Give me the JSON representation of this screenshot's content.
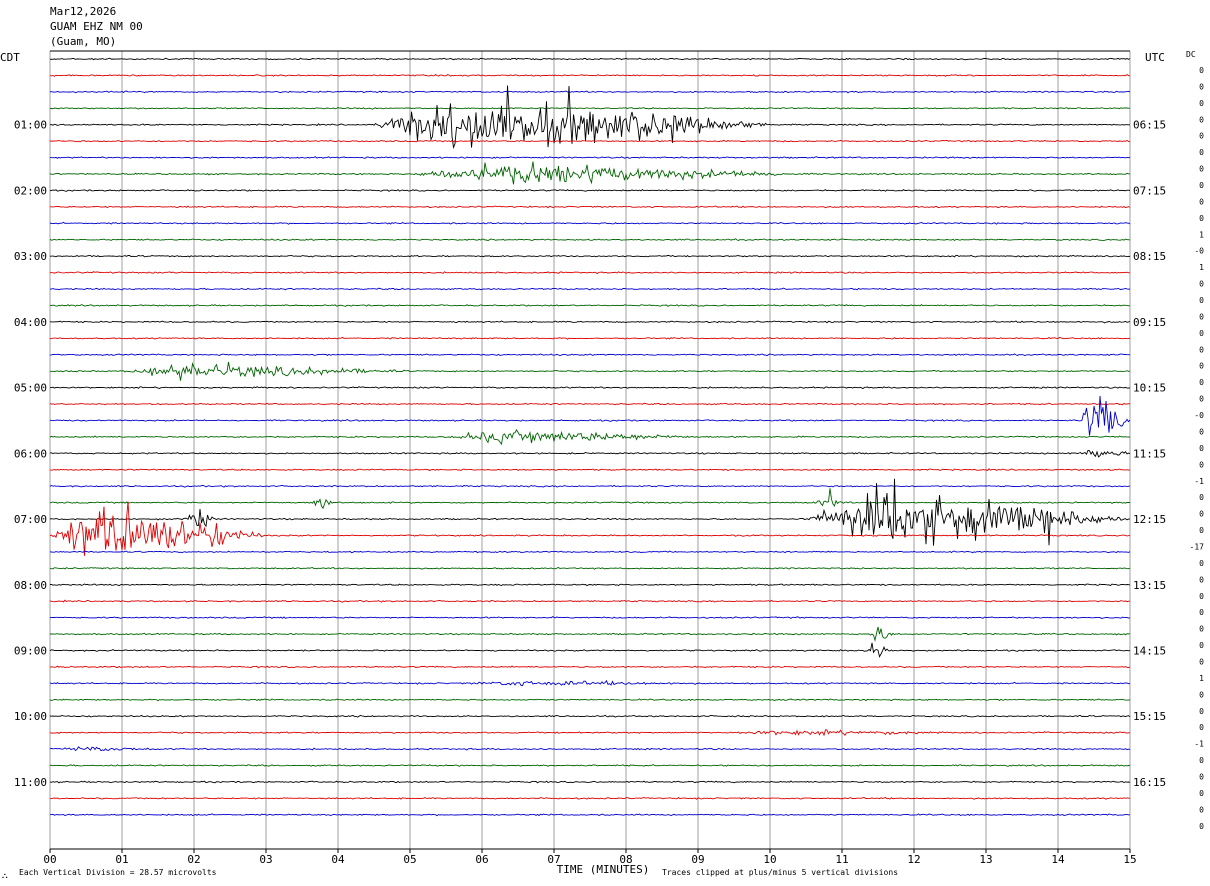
{
  "header": {
    "date": "Mar12,2026",
    "station": "GUAM EHZ NM 00",
    "location": "(Guam, MO)"
  },
  "labels": {
    "left_tz": "CDT",
    "right_tz": "UTC",
    "dc": "DC",
    "xlabel": "TIME (MINUTES)",
    "scale_note": "Each Vertical Division =   28.57 microvolts",
    "clip_note": "Traces clipped at plus/minus 5 vertical divisions"
  },
  "chart_data": {
    "type": "line",
    "title": "GUAM EHZ NM 00",
    "xlabel": "TIME (MINUTES)",
    "xlim": [
      0,
      15
    ],
    "x_ticks": [
      "00",
      "01",
      "02",
      "03",
      "04",
      "05",
      "06",
      "07",
      "08",
      "09",
      "10",
      "11",
      "12",
      "13",
      "14",
      "15"
    ],
    "left_hour_labels": [
      "01:00",
      "02:00",
      "03:00",
      "04:00",
      "05:00",
      "06:00",
      "07:00",
      "08:00",
      "09:00",
      "10:00",
      "11:00"
    ],
    "right_hour_labels": [
      "06:15",
      "07:15",
      "08:15",
      "09:15",
      "10:15",
      "11:15",
      "12:15",
      "13:15",
      "14:15",
      "15:15",
      "16:15"
    ],
    "trace_colors": [
      "#000000",
      "#e00000",
      "#0000d0",
      "#006400"
    ],
    "dc_offsets": [
      "0",
      "0",
      "0",
      "0",
      "0",
      "0",
      "0",
      "0",
      "0",
      "0",
      "1",
      "-0",
      "1",
      "0",
      "0",
      "0",
      "0",
      "0",
      "0",
      "0",
      "0",
      "-0",
      "0",
      "0",
      "0",
      "-1",
      "0",
      "0",
      "0",
      "-17",
      "0",
      "0",
      "0",
      "0",
      "0",
      "0",
      "0",
      "1",
      "0",
      "0",
      "0",
      "-1",
      "0",
      "0",
      "0",
      "0",
      "0"
    ],
    "events": [
      {
        "trace": 4,
        "start_min": 4.5,
        "end_min": 10.0,
        "amplitude": "clipped",
        "note": "large event"
      },
      {
        "trace": 7,
        "start_min": 5.0,
        "end_min": 10.5,
        "amplitude": "large"
      },
      {
        "trace": 19,
        "start_min": 1.0,
        "end_min": 5.0,
        "amplitude": "moderate"
      },
      {
        "trace": 23,
        "start_min": 5.5,
        "end_min": 9.0,
        "amplitude": "moderate"
      },
      {
        "trace": 22,
        "start_min": 14.3,
        "end_min": 15.0,
        "amplitude": "clipped"
      },
      {
        "trace": 24,
        "start_min": 14.3,
        "end_min": 15.0,
        "amplitude": "moderate"
      },
      {
        "trace": 27,
        "start_min": 3.6,
        "end_min": 4.0,
        "amplitude": "small burst"
      },
      {
        "trace": 27,
        "start_min": 10.6,
        "end_min": 11.1,
        "amplitude": "small burst"
      },
      {
        "trace": 28,
        "start_min": 1.8,
        "end_min": 2.4,
        "amplitude": "small burst"
      },
      {
        "trace": 28,
        "start_min": 10.5,
        "end_min": 15.0,
        "amplitude": "clipped"
      },
      {
        "trace": 29,
        "start_min": 0.0,
        "end_min": 3.0,
        "amplitude": "clipped"
      },
      {
        "trace": 35,
        "start_min": 11.3,
        "end_min": 11.8,
        "amplitude": "small burst"
      },
      {
        "trace": 36,
        "start_min": 11.3,
        "end_min": 11.7,
        "amplitude": "small burst"
      },
      {
        "trace": 38,
        "start_min": 5.8,
        "end_min": 9.0,
        "amplitude": "low"
      },
      {
        "trace": 41,
        "start_min": 9.5,
        "end_min": 12.5,
        "amplitude": "low"
      },
      {
        "trace": 42,
        "start_min": 0.0,
        "end_min": 1.5,
        "amplitude": "low"
      }
    ]
  }
}
